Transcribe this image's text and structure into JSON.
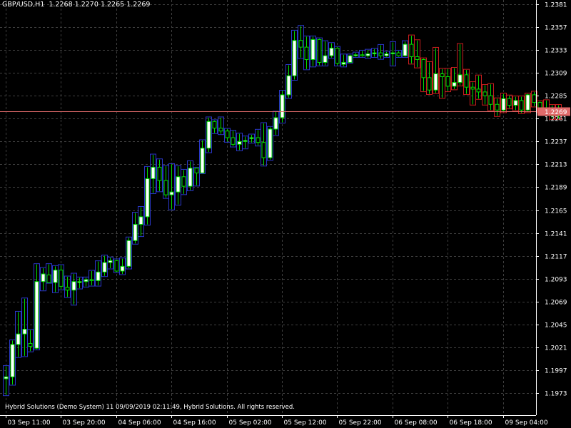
{
  "header": {
    "symbol": "GBP/USD,H1",
    "open": "1.2268",
    "high": "1.2270",
    "low": "1.2265",
    "close": "1.2269"
  },
  "footer": {
    "text": "Hybrid Solutions (Demo System) 11 09/09/2019 02:11:49, Hybrid Solutions. All rights reserved."
  },
  "colors": {
    "background": "#000000",
    "grid": "#3f3f3f",
    "axis": "#ffffff",
    "bull_body": "#ffffff",
    "bear_body": "#000000",
    "bull_wick": "#00e000",
    "bear_wick": "#00e000",
    "outline_blue": "#2a37c8",
    "outline_red": "#c81e1e",
    "price_line": "#e06a6a",
    "price_tag": "#e06a6a"
  },
  "chart_data": {
    "type": "candlestick",
    "title": "GBP/USD,H1",
    "ylim": [
      1.1961,
      1.2385
    ],
    "y_ticks": [
      "1.2381",
      "1.2357",
      "1.2333",
      "1.2309",
      "1.2285",
      "1.2261",
      "1.2237",
      "1.2213",
      "1.2189",
      "1.2165",
      "1.2141",
      "1.2117",
      "1.2093",
      "1.2069",
      "1.2045",
      "1.2021",
      "1.1997",
      "1.1973"
    ],
    "x_ticks": [
      "03 Sep 11:00",
      "03 Sep 20:00",
      "04 Sep 06:00",
      "04 Sep 16:00",
      "05 Sep 02:00",
      "05 Sep 12:00",
      "05 Sep 22:00",
      "06 Sep 08:00",
      "06 Sep 18:00",
      "09 Sep 04:00"
    ],
    "x_tick_bar_index": [
      0,
      9,
      18,
      27,
      36,
      45,
      54,
      63,
      72,
      81
    ],
    "current_price": "1.2269",
    "grid": true,
    "candles": [
      {
        "o": 1.1988,
        "h": 1.2001,
        "l": 1.1971,
        "c": 1.199
      },
      {
        "o": 1.199,
        "h": 1.2028,
        "l": 1.1982,
        "c": 1.2024
      },
      {
        "o": 1.2024,
        "h": 1.2058,
        "l": 1.2011,
        "c": 1.2035
      },
      {
        "o": 1.2035,
        "h": 1.2072,
        "l": 1.2012,
        "c": 1.204
      },
      {
        "o": 1.2025,
        "h": 1.2039,
        "l": 1.2017,
        "c": 1.2022
      },
      {
        "o": 1.202,
        "h": 1.2108,
        "l": 1.2019,
        "c": 1.209
      },
      {
        "o": 1.209,
        "h": 1.2104,
        "l": 1.2081,
        "c": 1.2098
      },
      {
        "o": 1.2097,
        "h": 1.2108,
        "l": 1.2089,
        "c": 1.2089
      },
      {
        "o": 1.2089,
        "h": 1.2106,
        "l": 1.2079,
        "c": 1.2102
      },
      {
        "o": 1.2102,
        "h": 1.2107,
        "l": 1.2082,
        "c": 1.2085
      },
      {
        "o": 1.2084,
        "h": 1.2095,
        "l": 1.2074,
        "c": 1.2081
      },
      {
        "o": 1.2081,
        "h": 1.2098,
        "l": 1.2066,
        "c": 1.209
      },
      {
        "o": 1.2089,
        "h": 1.2094,
        "l": 1.2083,
        "c": 1.209
      },
      {
        "o": 1.209,
        "h": 1.2094,
        "l": 1.2085,
        "c": 1.2092
      },
      {
        "o": 1.2092,
        "h": 1.2101,
        "l": 1.2086,
        "c": 1.2091
      },
      {
        "o": 1.2091,
        "h": 1.2111,
        "l": 1.2086,
        "c": 1.21
      },
      {
        "o": 1.21,
        "h": 1.2117,
        "l": 1.2096,
        "c": 1.211
      },
      {
        "o": 1.211,
        "h": 1.2115,
        "l": 1.2104,
        "c": 1.2112
      },
      {
        "o": 1.2112,
        "h": 1.2113,
        "l": 1.21,
        "c": 1.2101
      },
      {
        "o": 1.2101,
        "h": 1.2114,
        "l": 1.2098,
        "c": 1.2106
      },
      {
        "o": 1.2106,
        "h": 1.2136,
        "l": 1.2104,
        "c": 1.2133
      },
      {
        "o": 1.2133,
        "h": 1.2162,
        "l": 1.213,
        "c": 1.215
      },
      {
        "o": 1.215,
        "h": 1.2168,
        "l": 1.2138,
        "c": 1.2158
      },
      {
        "o": 1.2158,
        "h": 1.221,
        "l": 1.215,
        "c": 1.2198
      },
      {
        "o": 1.2198,
        "h": 1.2223,
        "l": 1.2183,
        "c": 1.221
      },
      {
        "o": 1.221,
        "h": 1.2218,
        "l": 1.2185,
        "c": 1.2196
      },
      {
        "o": 1.2196,
        "h": 1.2211,
        "l": 1.2178,
        "c": 1.2181
      },
      {
        "o": 1.2181,
        "h": 1.2213,
        "l": 1.2166,
        "c": 1.2184
      },
      {
        "o": 1.2184,
        "h": 1.2211,
        "l": 1.2171,
        "c": 1.22
      },
      {
        "o": 1.22,
        "h": 1.2207,
        "l": 1.2182,
        "c": 1.219
      },
      {
        "o": 1.219,
        "h": 1.2216,
        "l": 1.2186,
        "c": 1.2209
      },
      {
        "o": 1.2209,
        "h": 1.2209,
        "l": 1.2191,
        "c": 1.2204
      },
      {
        "o": 1.2204,
        "h": 1.2238,
        "l": 1.2204,
        "c": 1.223
      },
      {
        "o": 1.223,
        "h": 1.2262,
        "l": 1.2226,
        "c": 1.2258
      },
      {
        "o": 1.2258,
        "h": 1.2259,
        "l": 1.2246,
        "c": 1.2251
      },
      {
        "o": 1.2251,
        "h": 1.2262,
        "l": 1.2245,
        "c": 1.2248
      },
      {
        "o": 1.2248,
        "h": 1.225,
        "l": 1.2237,
        "c": 1.2241
      },
      {
        "o": 1.2241,
        "h": 1.2248,
        "l": 1.2232,
        "c": 1.2234
      },
      {
        "o": 1.2234,
        "h": 1.2245,
        "l": 1.2228,
        "c": 1.2237
      },
      {
        "o": 1.2237,
        "h": 1.2242,
        "l": 1.223,
        "c": 1.2238
      },
      {
        "o": 1.224,
        "h": 1.2244,
        "l": 1.2236,
        "c": 1.2241
      },
      {
        "o": 1.2241,
        "h": 1.2249,
        "l": 1.2233,
        "c": 1.2236
      },
      {
        "o": 1.2236,
        "h": 1.2256,
        "l": 1.2212,
        "c": 1.222
      },
      {
        "o": 1.222,
        "h": 1.2252,
        "l": 1.2218,
        "c": 1.225
      },
      {
        "o": 1.225,
        "h": 1.2268,
        "l": 1.2244,
        "c": 1.2262
      },
      {
        "o": 1.2262,
        "h": 1.229,
        "l": 1.2257,
        "c": 1.2286
      },
      {
        "o": 1.2286,
        "h": 1.2317,
        "l": 1.2283,
        "c": 1.2306
      },
      {
        "o": 1.2306,
        "h": 1.2353,
        "l": 1.2302,
        "c": 1.2343
      },
      {
        "o": 1.2343,
        "h": 1.2358,
        "l": 1.2325,
        "c": 1.2336
      },
      {
        "o": 1.2336,
        "h": 1.2347,
        "l": 1.2313,
        "c": 1.2323
      },
      {
        "o": 1.2323,
        "h": 1.2347,
        "l": 1.2316,
        "c": 1.2344
      },
      {
        "o": 1.2344,
        "h": 1.2345,
        "l": 1.2317,
        "c": 1.232
      },
      {
        "o": 1.232,
        "h": 1.2342,
        "l": 1.2317,
        "c": 1.2327
      },
      {
        "o": 1.2327,
        "h": 1.234,
        "l": 1.2325,
        "c": 1.2335
      },
      {
        "o": 1.2335,
        "h": 1.2336,
        "l": 1.2317,
        "c": 1.2319
      },
      {
        "o": 1.2318,
        "h": 1.2328,
        "l": 1.2316,
        "c": 1.232
      },
      {
        "o": 1.232,
        "h": 1.2328,
        "l": 1.232,
        "c": 1.2327
      },
      {
        "o": 1.2327,
        "h": 1.233,
        "l": 1.2326,
        "c": 1.2328
      },
      {
        "o": 1.2328,
        "h": 1.2332,
        "l": 1.2326,
        "c": 1.2327
      },
      {
        "o": 1.2327,
        "h": 1.2333,
        "l": 1.2325,
        "c": 1.2329
      },
      {
        "o": 1.2329,
        "h": 1.2334,
        "l": 1.2326,
        "c": 1.233
      },
      {
        "o": 1.233,
        "h": 1.2338,
        "l": 1.2324,
        "c": 1.2327
      },
      {
        "o": 1.2327,
        "h": 1.2331,
        "l": 1.2326,
        "c": 1.2329
      },
      {
        "o": 1.2329,
        "h": 1.2341,
        "l": 1.2317,
        "c": 1.233
      },
      {
        "o": 1.233,
        "h": 1.2332,
        "l": 1.2326,
        "c": 1.2327
      },
      {
        "o": 1.2327,
        "h": 1.2342,
        "l": 1.2326,
        "c": 1.2339
      },
      {
        "o": 1.2339,
        "h": 1.2348,
        "l": 1.2319,
        "c": 1.2326
      },
      {
        "o": 1.2326,
        "h": 1.2343,
        "l": 1.2315,
        "c": 1.2323
      },
      {
        "o": 1.2323,
        "h": 1.2324,
        "l": 1.229,
        "c": 1.2304
      },
      {
        "o": 1.2304,
        "h": 1.232,
        "l": 1.2287,
        "c": 1.2291
      },
      {
        "o": 1.2291,
        "h": 1.2335,
        "l": 1.2288,
        "c": 1.2308
      },
      {
        "o": 1.2308,
        "h": 1.2313,
        "l": 1.2283,
        "c": 1.2305
      },
      {
        "o": 1.2305,
        "h": 1.2313,
        "l": 1.229,
        "c": 1.2295
      },
      {
        "o": 1.2295,
        "h": 1.2314,
        "l": 1.2292,
        "c": 1.2299
      },
      {
        "o": 1.2299,
        "h": 1.2339,
        "l": 1.2296,
        "c": 1.2307
      },
      {
        "o": 1.2307,
        "h": 1.2312,
        "l": 1.2287,
        "c": 1.2294
      },
      {
        "o": 1.2294,
        "h": 1.2299,
        "l": 1.2276,
        "c": 1.2292
      },
      {
        "o": 1.2292,
        "h": 1.2306,
        "l": 1.2282,
        "c": 1.2289
      },
      {
        "o": 1.2289,
        "h": 1.2296,
        "l": 1.2276,
        "c": 1.2285
      },
      {
        "o": 1.2285,
        "h": 1.2297,
        "l": 1.227,
        "c": 1.2276
      },
      {
        "o": 1.2276,
        "h": 1.2282,
        "l": 1.2264,
        "c": 1.227
      },
      {
        "o": 1.227,
        "h": 1.2287,
        "l": 1.2268,
        "c": 1.2282
      },
      {
        "o": 1.2282,
        "h": 1.2285,
        "l": 1.2272,
        "c": 1.2275
      },
      {
        "o": 1.2275,
        "h": 1.2284,
        "l": 1.227,
        "c": 1.228
      },
      {
        "o": 1.228,
        "h": 1.2284,
        "l": 1.2267,
        "c": 1.227
      },
      {
        "o": 1.227,
        "h": 1.2287,
        "l": 1.2268,
        "c": 1.2286
      },
      {
        "o": 1.2286,
        "h": 1.2289,
        "l": 1.2274,
        "c": 1.2278
      },
      {
        "o": 1.2278,
        "h": 1.2279,
        "l": 1.2268,
        "c": 1.2272
      },
      {
        "o": 1.2272,
        "h": 1.228,
        "l": 1.2267,
        "c": 1.227
      },
      {
        "o": 1.227,
        "h": 1.2275,
        "l": 1.2261,
        "c": 1.2264
      },
      {
        "o": 1.2264,
        "h": 1.2275,
        "l": 1.2261,
        "c": 1.2269
      }
    ]
  }
}
